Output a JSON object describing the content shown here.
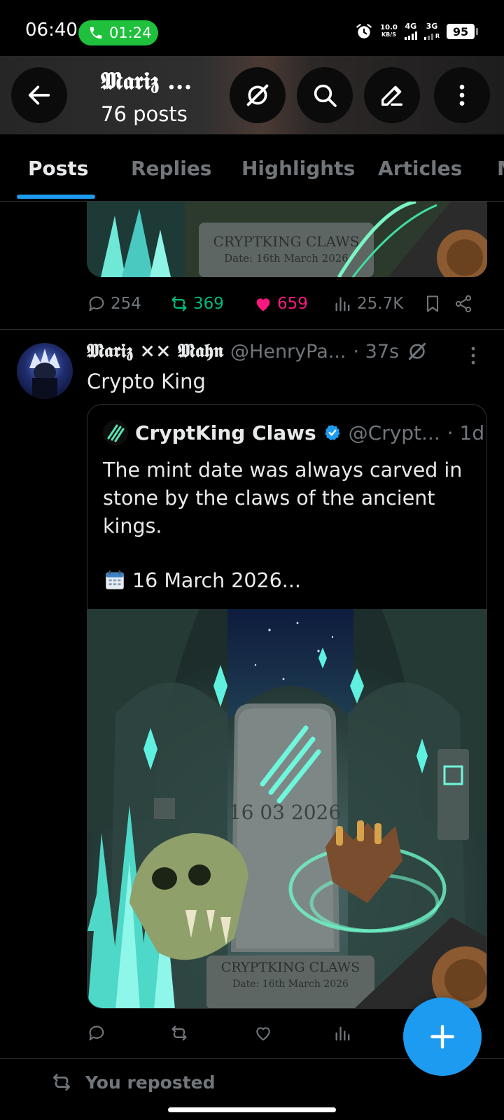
{
  "status_bar": {
    "time": "06:40",
    "call_timer": "01:24",
    "net_speed_value": "10.0",
    "net_speed_unit": "KB/S",
    "network_primary": "4G",
    "network_secondary": "3G",
    "network_secondary_sub": "R",
    "battery": "95"
  },
  "header": {
    "title": "𝕸𝖆𝖗𝖎𝖟 ...",
    "subtitle": "76 posts"
  },
  "tabs": [
    {
      "label": "Posts",
      "active": true
    },
    {
      "label": "Replies",
      "active": false
    },
    {
      "label": "Highlights",
      "active": false
    },
    {
      "label": "Articles",
      "active": false
    },
    {
      "label": "M",
      "active": false
    }
  ],
  "previous_post": {
    "media_caption_line1": "CRYPTKING CLAWS",
    "media_caption_line2": "Date: 16th March 2026",
    "replies": "254",
    "reposts": "369",
    "likes": "659",
    "views": "25.7K"
  },
  "post": {
    "author": "𝕸𝖆𝖗𝖎𝖟 ×× 𝕸𝖆𝖍𝖓",
    "handle": "@HenryPa...",
    "time": "· 37s",
    "text": "Crypto King",
    "quote": {
      "name": "CryptKing Claws",
      "handle": "@Crypt...",
      "time": "· 1d",
      "body": "The mint date was always carved in stone by the claws of the ancient kings.",
      "date_line": "16 March 2026...",
      "media_tomb_text": "16 03 2026",
      "media_caption_line1": "CRYPTKING CLAWS",
      "media_caption_line2": "Date: 16th March 2026"
    }
  },
  "reposted_label": "You reposted",
  "colors": {
    "accent": "#1d9bf0",
    "repost": "#00ba7c",
    "like": "#f91880",
    "muted": "#71767b",
    "call": "#1ec03c"
  }
}
